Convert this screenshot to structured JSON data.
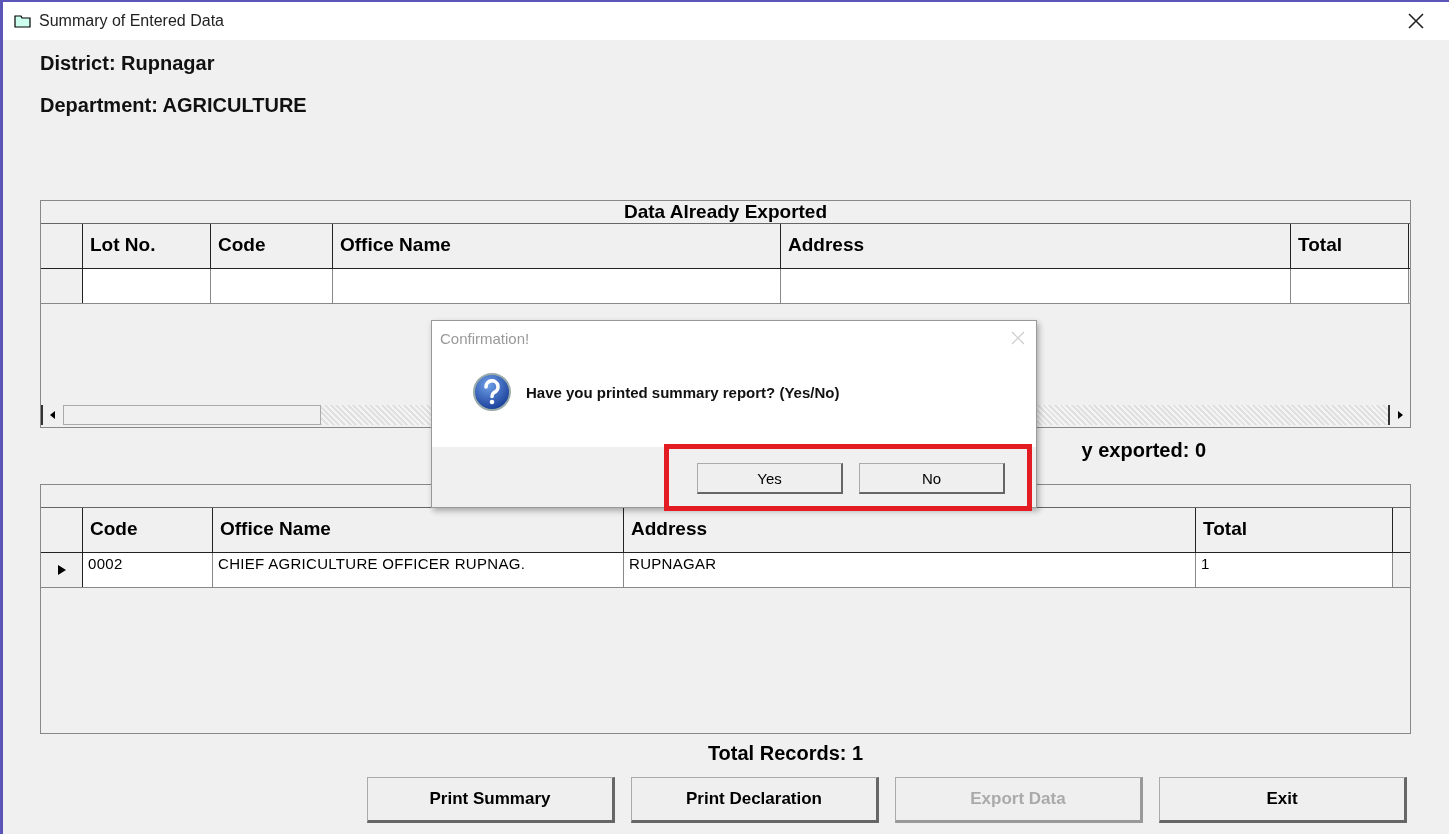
{
  "window": {
    "title": "Summary of Entered Data"
  },
  "district": "District: Rupnagar",
  "department": "Department: AGRICULTURE",
  "exported_table": {
    "caption": "Data Already Exported",
    "columns": [
      "Lot No.",
      "Code",
      "Office Name",
      "Address",
      "Total"
    ],
    "rows": [
      {
        "current": false,
        "cells": [
          "",
          "",
          "",
          "",
          ""
        ]
      }
    ]
  },
  "exported_count": "y exported: 0",
  "pending_table": {
    "columns": [
      "Code",
      "Office Name",
      "Address",
      "Total"
    ],
    "rows": [
      {
        "current": true,
        "cells": [
          "0002",
          "CHIEF AGRICULTURE OFFICER RUPNAG.",
          "RUPNAGAR",
          "1"
        ]
      }
    ]
  },
  "total_records": "Total Records: 1",
  "buttons": [
    {
      "label": "Print Summary",
      "disabled": false
    },
    {
      "label": "Print Declaration",
      "disabled": false
    },
    {
      "label": "Export Data",
      "disabled": true
    },
    {
      "label": "Exit",
      "disabled": false
    }
  ],
  "dialog": {
    "title": "Confirmation!",
    "message": "Have you printed summary report? (Yes/No)",
    "buttons": [
      {
        "label": "Yes"
      },
      {
        "label": "No"
      }
    ],
    "highlighted": true
  }
}
